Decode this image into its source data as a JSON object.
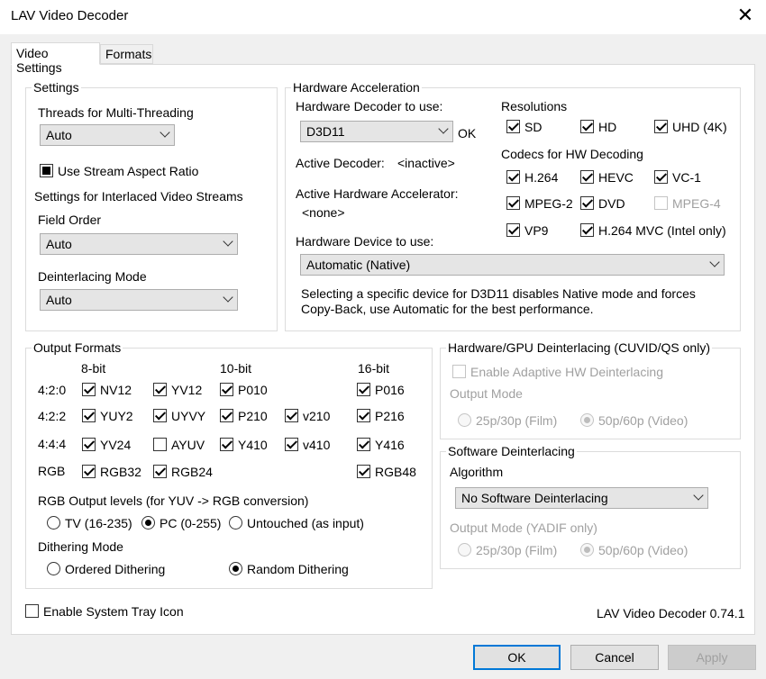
{
  "window": {
    "title": "LAV Video Decoder"
  },
  "tabs": {
    "video_settings": "Video Settings",
    "formats": "Formats"
  },
  "settings": {
    "group_label": "Settings",
    "threads_label": "Threads for Multi-Threading",
    "threads_value": "Auto",
    "stream_aspect_label": "Use Stream Aspect Ratio",
    "interlaced_label": "Settings for Interlaced Video Streams",
    "field_order_label": "Field Order",
    "field_order_value": "Auto",
    "deinterlacing_mode_label": "Deinterlacing Mode",
    "deinterlacing_mode_value": "Auto"
  },
  "hw": {
    "group_label": "Hardware Acceleration",
    "decoder_label": "Hardware Decoder to use:",
    "decoder_value": "D3D11",
    "decoder_status": "OK",
    "active_decoder_label": "Active Decoder:",
    "active_decoder_value": "<inactive>",
    "active_accel_label": "Active Hardware Accelerator:",
    "active_accel_value": "<none>",
    "device_label": "Hardware Device to use:",
    "device_value": "Automatic (Native)",
    "note_line1": "Selecting a specific device for D3D11 disables Native mode and forces",
    "note_line2": "Copy-Back, use Automatic for the best performance.",
    "resolutions_label": "Resolutions",
    "res_sd": "SD",
    "res_hd": "HD",
    "res_uhd": "UHD (4K)",
    "codecs_label": "Codecs for HW Decoding",
    "codec_h264": "H.264",
    "codec_hevc": "HEVC",
    "codec_vc1": "VC-1",
    "codec_mpeg2": "MPEG-2",
    "codec_dvd": "DVD",
    "codec_mpeg4": "MPEG-4",
    "codec_vp9": "VP9",
    "codec_h264mvc": "H.264 MVC (Intel only)"
  },
  "output": {
    "group_label": "Output Formats",
    "col_8bit": "8-bit",
    "col_10bit": "10-bit",
    "col_16bit": "16-bit",
    "row_420": "4:2:0",
    "row_422": "4:2:2",
    "row_444": "4:4:4",
    "row_rgb": "RGB",
    "nv12": "NV12",
    "yv12": "YV12",
    "p010": "P010",
    "p016": "P016",
    "yuy2": "YUY2",
    "uyvy": "UYVY",
    "p210": "P210",
    "v210": "v210",
    "p216": "P216",
    "yv24": "YV24",
    "ayuv": "AYUV",
    "y410": "Y410",
    "v410": "v410",
    "y416": "Y416",
    "rgb32": "RGB32",
    "rgb24": "RGB24",
    "rgb48": "RGB48",
    "rgb_levels_label": "RGB Output levels (for YUV -> RGB conversion)",
    "tv_label": "TV (16-235)",
    "pc_label": "PC (0-255)",
    "untouched_label": "Untouched (as input)",
    "dither_label": "Dithering Mode",
    "ordered_label": "Ordered Dithering",
    "random_label": "Random Dithering"
  },
  "hwdeint": {
    "group_label": "Hardware/GPU Deinterlacing (CUVID/QS only)",
    "adaptive_label": "Enable Adaptive HW Deinterlacing",
    "output_mode_label": "Output Mode",
    "film_label": "25p/30p (Film)",
    "video_label": "50p/60p (Video)"
  },
  "swdeint": {
    "group_label": "Software Deinterlacing",
    "algorithm_label": "Algorithm",
    "algorithm_value": "No Software Deinterlacing",
    "output_mode_label": "Output Mode (YADIF only)",
    "film_label": "25p/30p (Film)",
    "video_label": "50p/60p (Video)"
  },
  "footer": {
    "tray_label": "Enable System Tray Icon",
    "version": "LAV Video Decoder 0.74.1",
    "ok": "OK",
    "cancel": "Cancel",
    "apply": "Apply"
  }
}
